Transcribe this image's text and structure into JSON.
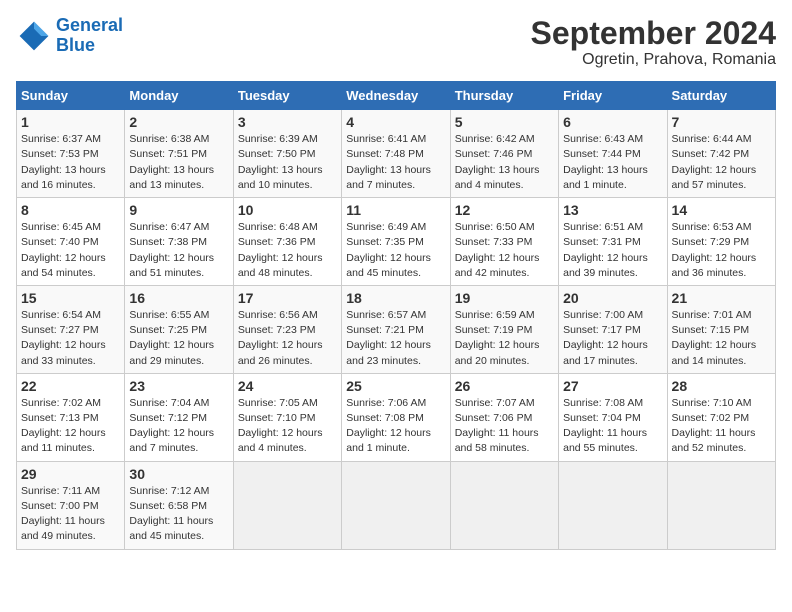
{
  "header": {
    "logo_line1": "General",
    "logo_line2": "Blue",
    "month_year": "September 2024",
    "location": "Ogretin, Prahova, Romania"
  },
  "days_of_week": [
    "Sunday",
    "Monday",
    "Tuesday",
    "Wednesday",
    "Thursday",
    "Friday",
    "Saturday"
  ],
  "weeks": [
    [
      {
        "day": "1",
        "sunrise": "Sunrise: 6:37 AM",
        "sunset": "Sunset: 7:53 PM",
        "daylight": "Daylight: 13 hours and 16 minutes."
      },
      {
        "day": "2",
        "sunrise": "Sunrise: 6:38 AM",
        "sunset": "Sunset: 7:51 PM",
        "daylight": "Daylight: 13 hours and 13 minutes."
      },
      {
        "day": "3",
        "sunrise": "Sunrise: 6:39 AM",
        "sunset": "Sunset: 7:50 PM",
        "daylight": "Daylight: 13 hours and 10 minutes."
      },
      {
        "day": "4",
        "sunrise": "Sunrise: 6:41 AM",
        "sunset": "Sunset: 7:48 PM",
        "daylight": "Daylight: 13 hours and 7 minutes."
      },
      {
        "day": "5",
        "sunrise": "Sunrise: 6:42 AM",
        "sunset": "Sunset: 7:46 PM",
        "daylight": "Daylight: 13 hours and 4 minutes."
      },
      {
        "day": "6",
        "sunrise": "Sunrise: 6:43 AM",
        "sunset": "Sunset: 7:44 PM",
        "daylight": "Daylight: 13 hours and 1 minute."
      },
      {
        "day": "7",
        "sunrise": "Sunrise: 6:44 AM",
        "sunset": "Sunset: 7:42 PM",
        "daylight": "Daylight: 12 hours and 57 minutes."
      }
    ],
    [
      {
        "day": "8",
        "sunrise": "Sunrise: 6:45 AM",
        "sunset": "Sunset: 7:40 PM",
        "daylight": "Daylight: 12 hours and 54 minutes."
      },
      {
        "day": "9",
        "sunrise": "Sunrise: 6:47 AM",
        "sunset": "Sunset: 7:38 PM",
        "daylight": "Daylight: 12 hours and 51 minutes."
      },
      {
        "day": "10",
        "sunrise": "Sunrise: 6:48 AM",
        "sunset": "Sunset: 7:36 PM",
        "daylight": "Daylight: 12 hours and 48 minutes."
      },
      {
        "day": "11",
        "sunrise": "Sunrise: 6:49 AM",
        "sunset": "Sunset: 7:35 PM",
        "daylight": "Daylight: 12 hours and 45 minutes."
      },
      {
        "day": "12",
        "sunrise": "Sunrise: 6:50 AM",
        "sunset": "Sunset: 7:33 PM",
        "daylight": "Daylight: 12 hours and 42 minutes."
      },
      {
        "day": "13",
        "sunrise": "Sunrise: 6:51 AM",
        "sunset": "Sunset: 7:31 PM",
        "daylight": "Daylight: 12 hours and 39 minutes."
      },
      {
        "day": "14",
        "sunrise": "Sunrise: 6:53 AM",
        "sunset": "Sunset: 7:29 PM",
        "daylight": "Daylight: 12 hours and 36 minutes."
      }
    ],
    [
      {
        "day": "15",
        "sunrise": "Sunrise: 6:54 AM",
        "sunset": "Sunset: 7:27 PM",
        "daylight": "Daylight: 12 hours and 33 minutes."
      },
      {
        "day": "16",
        "sunrise": "Sunrise: 6:55 AM",
        "sunset": "Sunset: 7:25 PM",
        "daylight": "Daylight: 12 hours and 29 minutes."
      },
      {
        "day": "17",
        "sunrise": "Sunrise: 6:56 AM",
        "sunset": "Sunset: 7:23 PM",
        "daylight": "Daylight: 12 hours and 26 minutes."
      },
      {
        "day": "18",
        "sunrise": "Sunrise: 6:57 AM",
        "sunset": "Sunset: 7:21 PM",
        "daylight": "Daylight: 12 hours and 23 minutes."
      },
      {
        "day": "19",
        "sunrise": "Sunrise: 6:59 AM",
        "sunset": "Sunset: 7:19 PM",
        "daylight": "Daylight: 12 hours and 20 minutes."
      },
      {
        "day": "20",
        "sunrise": "Sunrise: 7:00 AM",
        "sunset": "Sunset: 7:17 PM",
        "daylight": "Daylight: 12 hours and 17 minutes."
      },
      {
        "day": "21",
        "sunrise": "Sunrise: 7:01 AM",
        "sunset": "Sunset: 7:15 PM",
        "daylight": "Daylight: 12 hours and 14 minutes."
      }
    ],
    [
      {
        "day": "22",
        "sunrise": "Sunrise: 7:02 AM",
        "sunset": "Sunset: 7:13 PM",
        "daylight": "Daylight: 12 hours and 11 minutes."
      },
      {
        "day": "23",
        "sunrise": "Sunrise: 7:04 AM",
        "sunset": "Sunset: 7:12 PM",
        "daylight": "Daylight: 12 hours and 7 minutes."
      },
      {
        "day": "24",
        "sunrise": "Sunrise: 7:05 AM",
        "sunset": "Sunset: 7:10 PM",
        "daylight": "Daylight: 12 hours and 4 minutes."
      },
      {
        "day": "25",
        "sunrise": "Sunrise: 7:06 AM",
        "sunset": "Sunset: 7:08 PM",
        "daylight": "Daylight: 12 hours and 1 minute."
      },
      {
        "day": "26",
        "sunrise": "Sunrise: 7:07 AM",
        "sunset": "Sunset: 7:06 PM",
        "daylight": "Daylight: 11 hours and 58 minutes."
      },
      {
        "day": "27",
        "sunrise": "Sunrise: 7:08 AM",
        "sunset": "Sunset: 7:04 PM",
        "daylight": "Daylight: 11 hours and 55 minutes."
      },
      {
        "day": "28",
        "sunrise": "Sunrise: 7:10 AM",
        "sunset": "Sunset: 7:02 PM",
        "daylight": "Daylight: 11 hours and 52 minutes."
      }
    ],
    [
      {
        "day": "29",
        "sunrise": "Sunrise: 7:11 AM",
        "sunset": "Sunset: 7:00 PM",
        "daylight": "Daylight: 11 hours and 49 minutes."
      },
      {
        "day": "30",
        "sunrise": "Sunrise: 7:12 AM",
        "sunset": "Sunset: 6:58 PM",
        "daylight": "Daylight: 11 hours and 45 minutes."
      },
      null,
      null,
      null,
      null,
      null
    ]
  ]
}
